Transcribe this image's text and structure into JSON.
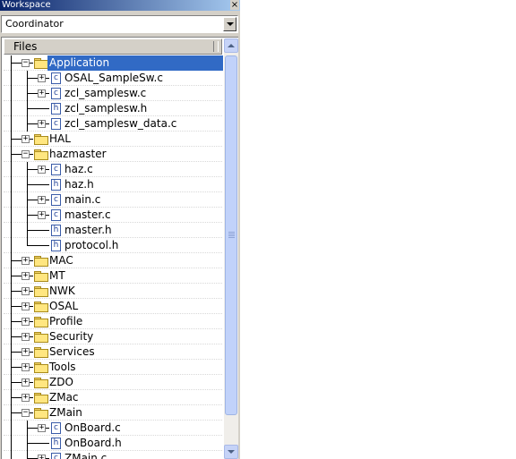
{
  "window": {
    "title": "Workspace",
    "close_glyph": "×"
  },
  "configuration": {
    "selected": "Coordinator"
  },
  "tree_header": {
    "label": "Files"
  },
  "tree": [
    {
      "label": "Application",
      "kind": "folder",
      "level": 0,
      "state": "expanded",
      "selected": true
    },
    {
      "label": "OSAL_SampleSw.c",
      "kind": "c-file",
      "level": 1,
      "state": "collapsed"
    },
    {
      "label": "zcl_samplesw.c",
      "kind": "c-file",
      "level": 1,
      "state": "collapsed"
    },
    {
      "label": "zcl_samplesw.h",
      "kind": "h-file",
      "level": 1,
      "state": "none"
    },
    {
      "label": "zcl_samplesw_data.c",
      "kind": "c-file",
      "level": 1,
      "state": "collapsed"
    },
    {
      "label": "HAL",
      "kind": "folder",
      "level": 0,
      "state": "collapsed"
    },
    {
      "label": "hazmaster",
      "kind": "folder",
      "level": 0,
      "state": "expanded"
    },
    {
      "label": "haz.c",
      "kind": "c-file",
      "level": 1,
      "state": "collapsed"
    },
    {
      "label": "haz.h",
      "kind": "h-file",
      "level": 1,
      "state": "none"
    },
    {
      "label": "main.c",
      "kind": "c-file",
      "level": 1,
      "state": "collapsed"
    },
    {
      "label": "master.c",
      "kind": "c-file",
      "level": 1,
      "state": "collapsed"
    },
    {
      "label": "master.h",
      "kind": "h-file",
      "level": 1,
      "state": "none"
    },
    {
      "label": "protocol.h",
      "kind": "h-file",
      "level": 1,
      "state": "none",
      "last_child": true
    },
    {
      "label": "MAC",
      "kind": "folder",
      "level": 0,
      "state": "collapsed"
    },
    {
      "label": "MT",
      "kind": "folder",
      "level": 0,
      "state": "collapsed"
    },
    {
      "label": "NWK",
      "kind": "folder",
      "level": 0,
      "state": "collapsed"
    },
    {
      "label": "OSAL",
      "kind": "folder",
      "level": 0,
      "state": "collapsed"
    },
    {
      "label": "Profile",
      "kind": "folder",
      "level": 0,
      "state": "collapsed"
    },
    {
      "label": "Security",
      "kind": "folder",
      "level": 0,
      "state": "collapsed"
    },
    {
      "label": "Services",
      "kind": "folder",
      "level": 0,
      "state": "collapsed"
    },
    {
      "label": "Tools",
      "kind": "folder",
      "level": 0,
      "state": "collapsed"
    },
    {
      "label": "ZDO",
      "kind": "folder",
      "level": 0,
      "state": "collapsed"
    },
    {
      "label": "ZMac",
      "kind": "folder",
      "level": 0,
      "state": "collapsed"
    },
    {
      "label": "ZMain",
      "kind": "folder",
      "level": 0,
      "state": "expanded"
    },
    {
      "label": "OnBoard.c",
      "kind": "c-file",
      "level": 1,
      "state": "collapsed"
    },
    {
      "label": "OnBoard.h",
      "kind": "h-file",
      "level": 1,
      "state": "none"
    },
    {
      "label": "ZMain.c",
      "kind": "c-file",
      "level": 1,
      "state": "collapsed"
    }
  ],
  "icons": {
    "c_file_letter": "c",
    "h_file_letter": "h",
    "expand_glyph": "+",
    "collapse_glyph": "−"
  },
  "colors": {
    "selection": "#316ac5",
    "titlebar": "#0a246a",
    "scrollbar": "#c1d2fa"
  }
}
